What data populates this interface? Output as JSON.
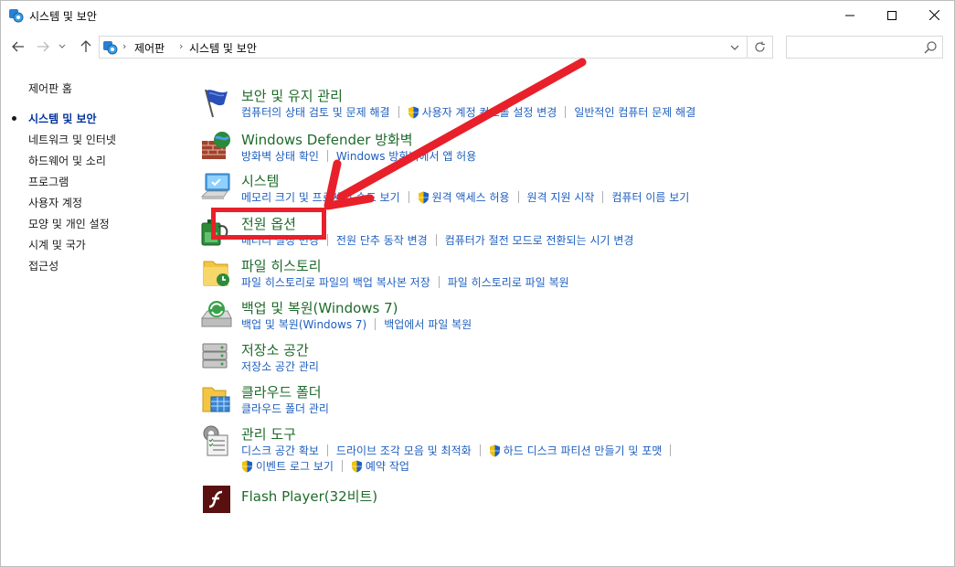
{
  "window": {
    "title": "시스템 및 보안",
    "minimize_glyph": "—",
    "maximize_glyph": "☐",
    "close_glyph": "✕"
  },
  "address": {
    "crumbs": [
      "제어판",
      "시스템 및 보안"
    ],
    "separator": "›",
    "search_placeholder": ""
  },
  "leftnav": {
    "items": [
      {
        "label": "제어판 홈",
        "kind": "home"
      },
      {
        "label": "시스템 및 보안",
        "kind": "current"
      },
      {
        "label": "네트워크 및 인터넷",
        "kind": "link"
      },
      {
        "label": "하드웨어 및 소리",
        "kind": "link"
      },
      {
        "label": "프로그램",
        "kind": "link"
      },
      {
        "label": "사용자 계정",
        "kind": "link"
      },
      {
        "label": "모양 및 개인 설정",
        "kind": "link"
      },
      {
        "label": "시계 및 국가",
        "kind": "link"
      },
      {
        "label": "접근성",
        "kind": "link"
      }
    ]
  },
  "categories": [
    {
      "title": "보안 및 유지 관리",
      "icon": "flag-icon",
      "rows": [
        [
          {
            "label": "컴퓨터의 상태 검토 및 문제 해결",
            "shield": false
          },
          {
            "label": "사용자 계정 컨트롤 설정 변경",
            "shield": true
          },
          {
            "label": "일반적인 컴퓨터 문제 해결",
            "shield": false
          }
        ]
      ]
    },
    {
      "title": "Windows Defender 방화벽",
      "icon": "firewall-icon",
      "rows": [
        [
          {
            "label": "방화벽 상태 확인",
            "shield": false
          },
          {
            "label": "Windows 방화벽에서 앱 허용",
            "shield": false
          }
        ]
      ]
    },
    {
      "title": "시스템",
      "icon": "computer-icon",
      "rows": [
        [
          {
            "label": "메모리 크기 및 프로세서 속도 보기",
            "shield": false
          },
          {
            "label": "원격 액세스 허용",
            "shield": true
          },
          {
            "label": "원격 지원 시작",
            "shield": false
          },
          {
            "label": "컴퓨터 이름 보기",
            "shield": false
          }
        ]
      ]
    },
    {
      "title": "전원 옵션",
      "icon": "battery-icon",
      "rows": [
        [
          {
            "label": "배터리 설정 변경",
            "shield": false
          },
          {
            "label": "전원 단추 동작 변경",
            "shield": false
          },
          {
            "label": "컴퓨터가 절전 모드로 전환되는 시기 변경",
            "shield": false
          }
        ]
      ]
    },
    {
      "title": "파일 히스토리",
      "icon": "file-history-icon",
      "rows": [
        [
          {
            "label": "파일 히스토리로 파일의 백업 복사본 저장",
            "shield": false
          },
          {
            "label": "파일 히스토리로 파일 복원",
            "shield": false
          }
        ]
      ]
    },
    {
      "title": "백업 및 복원(Windows 7)",
      "icon": "backup-icon",
      "rows": [
        [
          {
            "label": "백업 및 복원(Windows 7)",
            "shield": false
          },
          {
            "label": "백업에서 파일 복원",
            "shield": false
          }
        ]
      ]
    },
    {
      "title": "저장소 공간",
      "icon": "storage-icon",
      "rows": [
        [
          {
            "label": "저장소 공간 관리",
            "shield": false
          }
        ]
      ]
    },
    {
      "title": "클라우드 폴더",
      "icon": "cloud-folder-icon",
      "rows": [
        [
          {
            "label": "클라우드 폴더 관리",
            "shield": false
          }
        ]
      ]
    },
    {
      "title": "관리 도구",
      "icon": "admin-tools-icon",
      "rows": [
        [
          {
            "label": "디스크 공간 확보",
            "shield": false
          },
          {
            "label": "드라이브 조각 모음 및 최적화",
            "shield": false
          },
          {
            "label": "하드 디스크 파티션 만들기 및 포맷",
            "shield": true
          }
        ],
        [
          {
            "label": "이벤트 로그 보기",
            "shield": true
          },
          {
            "label": "예약 작업",
            "shield": true
          }
        ]
      ]
    },
    {
      "title": "Flash Player(32비트)",
      "icon": "flash-icon",
      "rows": []
    }
  ],
  "colors": {
    "category_title": "#1e6b2a",
    "link": "#1f5fbf",
    "annotation": "#e8202a"
  }
}
